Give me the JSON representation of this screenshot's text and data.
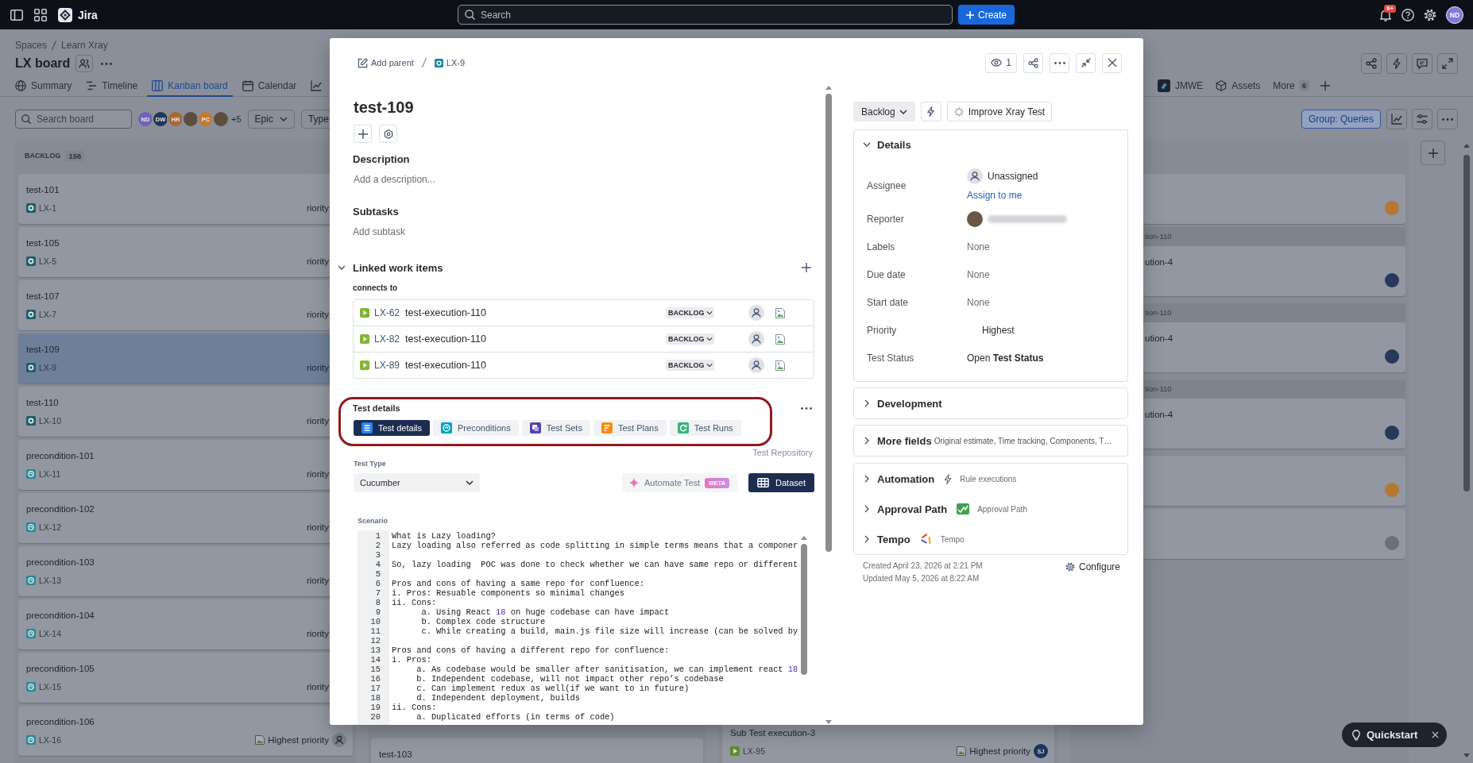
{
  "top_nav": {
    "product": "Jira",
    "search": {
      "placeholder": "Search"
    },
    "create_label": "Create",
    "notification_count": "9+",
    "user_initials": "ND"
  },
  "board": {
    "breadcrumbs": [
      "Spaces",
      "Learn Xray"
    ],
    "title": "LX board",
    "tabs": [
      {
        "label": "Summary",
        "selected": false
      },
      {
        "label": "Timeline",
        "selected": false
      },
      {
        "label": "Kanban board",
        "selected": true
      },
      {
        "label": "Calendar",
        "selected": false
      }
    ],
    "tabs_right": [
      {
        "label": "JMWE",
        "selected": false
      },
      {
        "label": "Assets",
        "selected": false
      },
      {
        "label": "More",
        "count": "6",
        "selected": false
      }
    ],
    "search": {
      "placeholder": "Search board"
    },
    "people": [
      {
        "kind": "initials",
        "initials": "ND",
        "color": "#6f63b8"
      },
      {
        "kind": "initials",
        "initials": "DW",
        "color": "#1f3656"
      },
      {
        "kind": "initials",
        "initials": "HR",
        "color": "#a8692f"
      },
      {
        "kind": "photo"
      },
      {
        "kind": "initials",
        "initials": "PC",
        "color": "#c47a35"
      },
      {
        "kind": "photo"
      }
    ],
    "people_more": "+5",
    "filters": [
      {
        "label": "Epic",
        "dropdown": true
      },
      {
        "label": "Type",
        "dropdown": false
      }
    ],
    "group_by": "Group: Queries",
    "columns": [
      {
        "header": "BACKLOG",
        "count": "156",
        "items": [
          {
            "kind": "test",
            "title": "test-101",
            "key": "LX-1",
            "priority": "riority",
            "priority_icon": false,
            "selected": false
          },
          {
            "kind": "test",
            "title": "test-105",
            "key": "LX-5",
            "priority": "riority",
            "priority_icon": false,
            "selected": false
          },
          {
            "kind": "test",
            "title": "test-107",
            "key": "LX-7",
            "priority": "riority",
            "priority_icon": false,
            "selected": false
          },
          {
            "kind": "test",
            "title": "test-109",
            "key": "LX-9",
            "priority": "riority",
            "priority_icon": false,
            "selected": true
          },
          {
            "kind": "test",
            "title": "test-110",
            "key": "LX-10",
            "priority": "riority",
            "priority_icon": false,
            "selected": false
          },
          {
            "kind": "precondition",
            "title": "precondition-101",
            "key": "LX-11",
            "priority": "riority",
            "priority_icon": false,
            "selected": false
          },
          {
            "kind": "precondition",
            "title": "precondition-102",
            "key": "LX-12",
            "priority": "riority",
            "priority_icon": false,
            "selected": false
          },
          {
            "kind": "precondition",
            "title": "precondition-103",
            "key": "LX-13",
            "priority": "riority",
            "priority_icon": false,
            "selected": false
          },
          {
            "kind": "precondition",
            "title": "precondition-104",
            "key": "LX-14",
            "priority": "riority",
            "priority_icon": false,
            "selected": false
          },
          {
            "kind": "precondition",
            "title": "precondition-105",
            "key": "LX-15",
            "priority": "riority",
            "priority_icon": false,
            "selected": false
          },
          {
            "kind": "precondition",
            "title": "precondition-106",
            "key": "LX-16",
            "priority": "Highest priority",
            "priority_icon": true,
            "selected": false,
            "assignee": {
              "kind": "unassigned"
            }
          }
        ]
      },
      {
        "items": [
          {
            "kind": "card",
            "title": "test-103",
            "selected": false
          }
        ]
      },
      {
        "items": [
          {
            "kind": "execution",
            "title": "Sub Test execution-3",
            "key": "LX-95",
            "priority": "Highest priority",
            "priority_icon": true,
            "selected": false,
            "assignee": {
              "kind": "initials",
              "initials": "SJ",
              "color": "#1e3560"
            }
          }
        ]
      },
      {
        "items": [
          {
            "kind": "card",
            "selected": false,
            "assignee": {
              "kind": "plain",
              "color": "#b4782f"
            }
          },
          {
            "kind": "group",
            "label": "tion-110"
          },
          {
            "kind": "card",
            "title": "ution-4",
            "selected": false,
            "assignee": {
              "kind": "plain",
              "color": "#26395c"
            }
          },
          {
            "kind": "group",
            "label": "tion-110"
          },
          {
            "kind": "card",
            "title": "ution-4",
            "selected": false,
            "assignee": {
              "kind": "plain",
              "color": "#26395c"
            }
          },
          {
            "kind": "group",
            "label": "tion-110"
          },
          {
            "kind": "card",
            "title": "ution-4",
            "selected": false,
            "assignee": {
              "kind": "plain",
              "color": "#26395c"
            }
          },
          {
            "kind": "card",
            "selected": false,
            "assignee": {
              "kind": "plain",
              "color": "#b4782f"
            }
          },
          {
            "kind": "card",
            "selected": false,
            "assignee": {
              "kind": "plain",
              "color": "#6d7079"
            }
          }
        ]
      }
    ]
  },
  "work_item": {
    "add_parent": "Add parent",
    "key": "LX-9",
    "watchers": "1",
    "title": "test-109",
    "description": {
      "heading": "Description",
      "placeholder": "Add a description..."
    },
    "subtasks": {
      "heading": "Subtasks",
      "add_label": "Add subtask"
    },
    "linked": {
      "heading": "Linked work items",
      "expanded": true,
      "relation": "connects to",
      "items": [
        {
          "key": "LX-62",
          "summary": "test-execution-110",
          "status": "BACKLOG"
        },
        {
          "key": "LX-82",
          "summary": "test-execution-110",
          "status": "BACKLOG"
        },
        {
          "key": "LX-89",
          "summary": "test-execution-110",
          "status": "BACKLOG"
        }
      ]
    },
    "test_details": {
      "heading": "Test details",
      "tabs": [
        {
          "label": "Test details",
          "selected": true
        },
        {
          "label": "Preconditions",
          "selected": false
        },
        {
          "label": "Test Sets",
          "selected": false
        },
        {
          "label": "Test Plans",
          "selected": false
        },
        {
          "label": "Test Runs",
          "selected": false
        }
      ],
      "repository_link": "Test Repository",
      "test_type_label": "Test Type",
      "test_type": "Cucumber",
      "automate_label": "Automate Test",
      "automate_badge": "BETA",
      "dataset_label": "Dataset",
      "scenario_label": "Scenario",
      "scenario_lines": [
        {
          "number": "1",
          "tokens": [
            {
              "text": "What is Lazy loading?",
              "kind": "plain"
            }
          ]
        },
        {
          "number": "2",
          "tokens": [
            {
              "text": "Lazy loading also referred as code splitting in simple terms means that a componer",
              "kind": "plain"
            }
          ]
        },
        {
          "number": "3"
        },
        {
          "number": "4",
          "tokens": [
            {
              "text": "So, lazy loading  POC was done to check whether we can have same repo or different",
              "kind": "plain"
            }
          ]
        },
        {
          "number": "5"
        },
        {
          "number": "6",
          "tokens": [
            {
              "text": "Pros and cons of having a same repo for confluence:",
              "kind": "plain"
            }
          ]
        },
        {
          "number": "7",
          "tokens": [
            {
              "text": "i. Pros: Resuable components so minimal changes",
              "kind": "plain"
            }
          ]
        },
        {
          "number": "8",
          "tokens": [
            {
              "text": "ii. Cons:",
              "kind": "plain"
            }
          ]
        },
        {
          "number": "9",
          "tokens": [
            {
              "text": "      a. Using React ",
              "kind": "plain"
            },
            {
              "text": "18",
              "kind": "number"
            },
            {
              "text": " on huge codebase can have impact",
              "kind": "plain"
            }
          ]
        },
        {
          "number": "10",
          "tokens": [
            {
              "text": "      b. Complex code structure",
              "kind": "plain"
            }
          ]
        },
        {
          "number": "11",
          "tokens": [
            {
              "text": "      c. While creating a build, main.js file size will increase (can be solved by",
              "kind": "plain"
            }
          ]
        },
        {
          "number": "12"
        },
        {
          "number": "13",
          "tokens": [
            {
              "text": "Pros and cons of having a different repo for confluence:",
              "kind": "plain"
            }
          ]
        },
        {
          "number": "14",
          "tokens": [
            {
              "text": "i. Pros:",
              "kind": "plain"
            }
          ]
        },
        {
          "number": "15",
          "tokens": [
            {
              "text": "     a. As codebase would be smaller after sanitisation, we can implement react ",
              "kind": "plain"
            },
            {
              "text": "18",
              "kind": "number"
            }
          ]
        },
        {
          "number": "16",
          "tokens": [
            {
              "text": "     b. Independent codebase, will not impact other repo’s codebase",
              "kind": "plain"
            }
          ]
        },
        {
          "number": "17",
          "tokens": [
            {
              "text": "     c. Can implement redux as well(if we want to in future)",
              "kind": "plain"
            }
          ]
        },
        {
          "number": "18",
          "tokens": [
            {
              "text": "     d. Independent deployment, builds",
              "kind": "plain"
            }
          ]
        },
        {
          "number": "19",
          "tokens": [
            {
              "text": "ii. Cons:",
              "kind": "plain"
            }
          ]
        },
        {
          "number": "20",
          "tokens": [
            {
              "text": "     a. Duplicated efforts (in terms of code)",
              "kind": "plain"
            }
          ]
        }
      ]
    },
    "status": "Backlog",
    "improve_label": "Improve Xray Test",
    "details": {
      "heading": "Details",
      "expanded": true,
      "fields": [
        {
          "label": "Assignee",
          "kind": "assignee",
          "value": "Unassigned",
          "action": "Assign to me"
        },
        {
          "label": "Reporter",
          "kind": "reporter"
        },
        {
          "label": "Labels",
          "kind": "none",
          "value": "None"
        },
        {
          "label": "Due date",
          "kind": "none",
          "value": "None"
        },
        {
          "label": "Start date",
          "kind": "none",
          "value": "None"
        },
        {
          "label": "Priority",
          "kind": "priority",
          "value": "Highest"
        },
        {
          "label": "Test Status",
          "kind": "rich",
          "value": "Open **Test Status**"
        }
      ]
    },
    "sections": [
      {
        "title": "Development",
        "expanded": false
      },
      {
        "title": "More fields",
        "summary": "Original estimate, Time tracking, Components, T…",
        "expanded": false
      }
    ],
    "apps": [
      {
        "title": "Automation",
        "caption": "Rule executions",
        "expanded": false
      },
      {
        "title": "Approval Path",
        "caption": "Approval Path",
        "expanded": false
      },
      {
        "title": "Tempo",
        "caption": "Tempo",
        "expanded": false
      }
    ],
    "created": "Created April 23, 2026 at 2:21 PM",
    "updated": "Updated May 5, 2026 at 8:22 AM",
    "configure": "Configure"
  },
  "quickstart": {
    "label": "Quickstart"
  }
}
